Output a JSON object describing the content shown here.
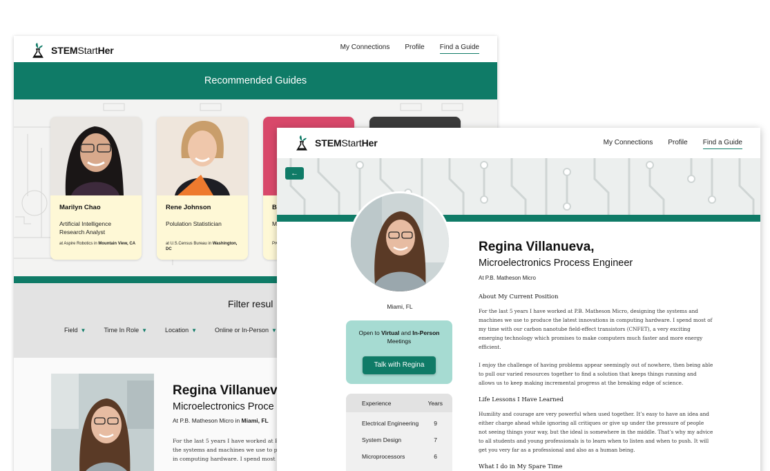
{
  "brand": {
    "part1": "STEM",
    "part2": "Start",
    "part3": "Her"
  },
  "nav": {
    "connections": "My Connections",
    "profile": "Profile",
    "find": "Find a Guide"
  },
  "recommended": {
    "banner": "Recommended Guides",
    "cards": [
      {
        "name": "Marilyn Chao",
        "role": "Artificial Intelligence Research Analyst",
        "org_prefix": "at Aspire Robotics in ",
        "org_place": "Mountain View, CA"
      },
      {
        "name": "Rene Johnson",
        "role": "Polulation Statistician",
        "org_prefix": "at U.S.Census Bureau in ",
        "org_place": "Washington, DC"
      },
      {
        "name": "B",
        "role": "M",
        "org_prefix": "Pr",
        "org_place": "Or"
      }
    ]
  },
  "filter": {
    "title": "Filter resul",
    "options": [
      "Field",
      "Time In Role",
      "Location",
      "Online or In-Person"
    ]
  },
  "back_profile": {
    "name": "Regina Villanuev",
    "title": "Microelectronics Proce",
    "at_prefix": "At P.B. Matheson Micro in ",
    "at_place": "Miami, FL",
    "para_lines": [
      "For the last 5 years I have worked at P.B.",
      "the systems and machines we use to pro",
      "in computing hardware. I spend most of"
    ]
  },
  "profile": {
    "back_arrow": "←",
    "name": "Regina Villanueva,",
    "title": "Microelectronics Process Engineer",
    "at": "At P.B. Matheson Micro",
    "city": "Miami, FL",
    "avail": {
      "p1": "Open to ",
      "b1": "Virtual",
      "p2": " and ",
      "b2": "In-Person",
      "p3": " Meetings"
    },
    "talk_button": "Talk with Regina",
    "experience": {
      "col1": "Experience",
      "col2": "Years",
      "rows": [
        {
          "label": "Electrical Engineering",
          "years": "9"
        },
        {
          "label": "System Design",
          "years": "7"
        },
        {
          "label": "Microprocessors",
          "years": "6"
        }
      ]
    },
    "sections": [
      {
        "heading": "About My Current Position",
        "paragraphs": [
          "For the last 5 years I have worked at P.B. Matheson Micro, designing the systems and machines we use to produce the latest innovations in computing hardware. I spend most of my time with our carbon nanotube field-effect transistors (CNFET), a very exciting emerging technology which promises to make computers much faster and more energy efficient.",
          "I enjoy the challenge of having problems appear seemingly out of nowhere, then being able to pull our varied resources together to find a solution that keeps things running and allows us to keep making incremental progress at the breaking edge of science."
        ]
      },
      {
        "heading": "Life Lessons I Have Learned",
        "paragraphs": [
          "Humility and courage are very powerful when used together. It’s easy to have an idea and either charge ahead while ignoring all critiques or give up under the pressure of people not seeing things your way, but the ideal is somewhere in the middle. That’s why my advice to all students and young professionals is to learn when to listen and when to push. It will get you very far as a professional and also as a human being."
        ]
      },
      {
        "heading": "What I do in My Spare Time",
        "paragraphs": []
      }
    ]
  },
  "colors": {
    "accent": "#0f7b67",
    "card": "#fef8d6",
    "avail": "#a6dbd2"
  }
}
